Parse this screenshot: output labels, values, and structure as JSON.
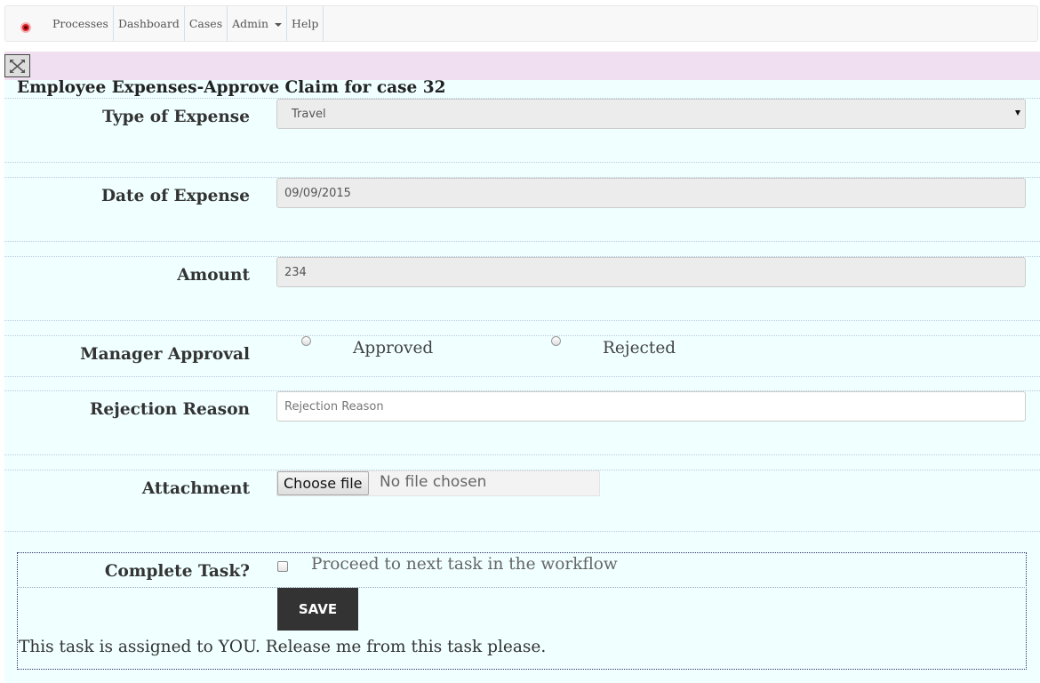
{
  "nav": {
    "items": [
      {
        "label": "Processes"
      },
      {
        "label": "Dashboard"
      },
      {
        "label": "Cases"
      },
      {
        "label": "Admin",
        "dropdown": true
      },
      {
        "label": "Help"
      }
    ],
    "logo_color": "#d9282f"
  },
  "form": {
    "title": "Employee Expenses-Approve Claim for case 32",
    "type_of_expense": {
      "label": "Type of Expense",
      "value": "Travel"
    },
    "date_of_expense": {
      "label": "Date of Expense",
      "value": "09/09/2015"
    },
    "amount": {
      "label": "Amount",
      "value": "234"
    },
    "manager_approval": {
      "label": "Manager Approval",
      "options": [
        "Approved",
        "Rejected"
      ],
      "selected": null
    },
    "rejection_reason": {
      "label": "Rejection Reason",
      "placeholder": "Rejection Reason",
      "value": ""
    },
    "attachment": {
      "label": "Attachment",
      "button": "Choose file",
      "status": "No file chosen"
    },
    "complete_task": {
      "label": "Complete Task?",
      "checkbox_label": "Proceed to next task in the workflow",
      "checked": false
    },
    "save_label": "SAVE",
    "assignment_text": "This task is assigned to YOU. Release me from this task please."
  },
  "colors": {
    "form_bg": "#f0ffff",
    "toolbar_band": "#efdff0",
    "save_button": "#333333"
  }
}
